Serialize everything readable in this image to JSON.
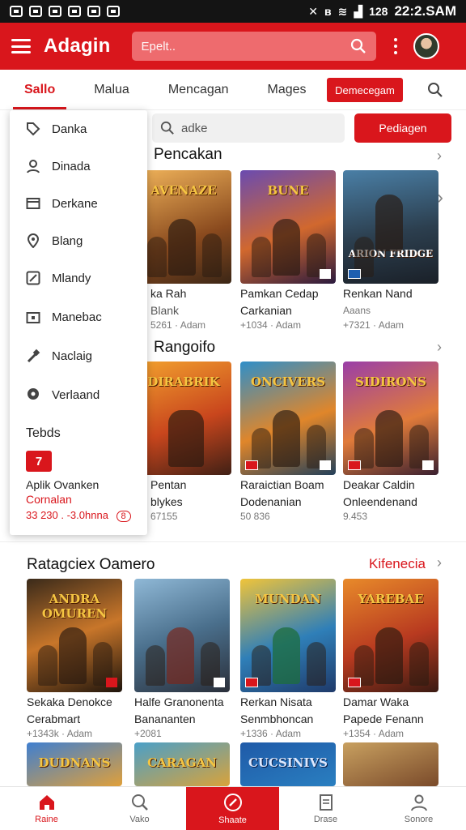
{
  "status_bar": {
    "time": "22:2.SAM",
    "battery": "128"
  },
  "header": {
    "title": "Adagin",
    "search_placeholder": "Epelt.."
  },
  "tabs": {
    "items": [
      "Sallo",
      "Malua",
      "Mencagan",
      "Mages"
    ],
    "pill": "Demecegam"
  },
  "filter": {
    "search_placeholder": "adke",
    "button": "Pediagen"
  },
  "drawer": {
    "items": [
      {
        "label": "Danka",
        "icon": "tag-icon"
      },
      {
        "label": "Dinada",
        "icon": "user-icon"
      },
      {
        "label": "Derkane",
        "icon": "folder-icon"
      },
      {
        "label": "Blang",
        "icon": "location-icon"
      },
      {
        "label": "Mlandy",
        "icon": "edit-icon"
      },
      {
        "label": "Manebac",
        "icon": "store-icon"
      },
      {
        "label": "Naclaig",
        "icon": "hammer-icon"
      },
      {
        "label": "Verlaand",
        "icon": "map-pin-icon"
      }
    ],
    "section_title": "Tebds",
    "app": {
      "badge": "7",
      "name": "Aplik Ovanken",
      "sub": "Cornalan",
      "meta": "33 230 . -3.0hnna",
      "rating": "8"
    }
  },
  "section1": {
    "title": "Pencakan",
    "cards": [
      {
        "name": "ka Rah",
        "sub": "Blank",
        "meta": "5261 · Adam",
        "cover_text": "AVENAZE"
      },
      {
        "name": "Pamkan Cedap",
        "sub": "Carkanian",
        "meta": "+1034 · Adam",
        "cover_text": "BUNE"
      },
      {
        "name": "Renkan Nand",
        "sub": "Aaans",
        "meta": "+7321 · Adam",
        "cover_text": "ARION FRIDGE"
      }
    ]
  },
  "section2": {
    "title": "Rangoifo",
    "cards": [
      {
        "name": "Pentan",
        "sub": "blykes",
        "meta": "67155",
        "cover_text": "DIRABRIK"
      },
      {
        "name": "Raraictian Boam",
        "sub": "Dodenanian",
        "meta": "50 836",
        "cover_text": "ONCIVERS"
      },
      {
        "name": "Deakar Caldin",
        "sub": "Onleendenand",
        "meta": "9.453",
        "cover_text": "SIDIRONS"
      }
    ]
  },
  "section3": {
    "title": "Ratagciex Oamero",
    "see_all": "Kifenecia",
    "cards": [
      {
        "name": "Sekaka Denokce",
        "sub": "Cerabmart",
        "meta": "+1343k · Adam",
        "cover_text": "ANDRA OMUREN"
      },
      {
        "name": "Halfe Granonenta",
        "sub": "Banananten",
        "meta": "+2081",
        "cover_text": ""
      },
      {
        "name": "Rerkan Nisata",
        "sub": "Senmbhoncan",
        "meta": "+1336 · Adam",
        "cover_text": "MUNDAN"
      },
      {
        "name": "Damar Waka",
        "sub": "Papede Fenann",
        "meta": "+1354 · Adam",
        "cover_text": "YAREBAE"
      }
    ]
  },
  "section4": {
    "cards": [
      {
        "cover_text": "DUDNANS"
      },
      {
        "cover_text": "CARAGAN"
      },
      {
        "cover_text": "CUCSINIVS"
      },
      {
        "cover_text": ""
      }
    ]
  },
  "bottom_nav": [
    "Raine",
    "Vako",
    "Shaate",
    "Drase",
    "Sonore"
  ]
}
